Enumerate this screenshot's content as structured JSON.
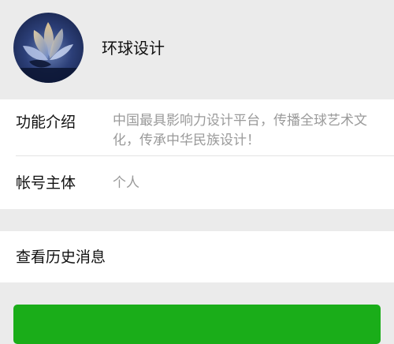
{
  "profile": {
    "name": "环球设计",
    "avatar_icon": "lotus-building-logo-icon"
  },
  "info": {
    "intro_label": "功能介绍",
    "intro_value": "中国最具影响力设计平台，传播全球艺术文化，传承中华民族设计！",
    "owner_label": "帐号主体",
    "owner_value": "个人"
  },
  "history": {
    "label": "查看历史消息"
  },
  "colors": {
    "background": "#ebebeb",
    "card": "#ffffff",
    "primary_text": "#111111",
    "secondary_text": "#9a9a9a",
    "button_green": "#1aad19"
  }
}
